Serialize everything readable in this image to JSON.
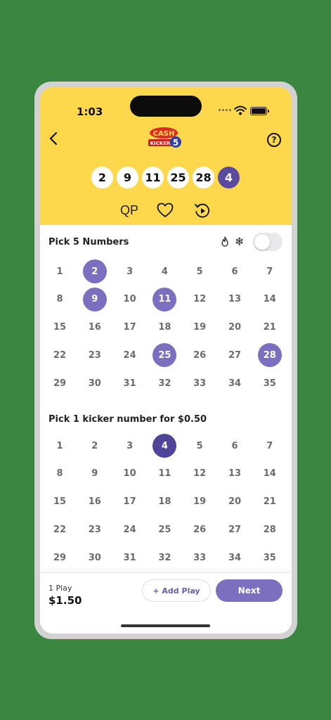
{
  "status_bar": {
    "time": "1:03"
  },
  "header": {
    "logo_text": "CASH 5 KICKER",
    "help_label": "?",
    "selected_numbers": [
      "2",
      "9",
      "11",
      "25",
      "28"
    ],
    "selected_kicker": "4",
    "quick_pick_label": "QP"
  },
  "pick5": {
    "title": "Pick 5 Numbers",
    "numbers": [
      1,
      2,
      3,
      4,
      5,
      6,
      7,
      8,
      9,
      10,
      11,
      12,
      13,
      14,
      15,
      16,
      17,
      18,
      19,
      20,
      21,
      22,
      23,
      24,
      25,
      26,
      27,
      28,
      29,
      30,
      31,
      32,
      33,
      34,
      35
    ],
    "selected": [
      2,
      9,
      11,
      25,
      28
    ]
  },
  "kicker": {
    "title": "Pick 1 kicker number for $0.50",
    "numbers": [
      1,
      2,
      3,
      4,
      5,
      6,
      7,
      8,
      9,
      10,
      11,
      12,
      13,
      14,
      15,
      16,
      17,
      18,
      19,
      20,
      21,
      22,
      23,
      24,
      25,
      26,
      27,
      28,
      29,
      30,
      31,
      32,
      33,
      34,
      35
    ],
    "selected": [
      4
    ]
  },
  "footer": {
    "play_count": "1 Play",
    "price": "$1.50",
    "add_play_label": "+ Add Play",
    "next_label": "Next"
  },
  "colors": {
    "background": "#3a8540",
    "header_yellow": "#fdd84c",
    "selected_purple": "#7d6fc0",
    "kicker_purple": "#4f449a"
  }
}
